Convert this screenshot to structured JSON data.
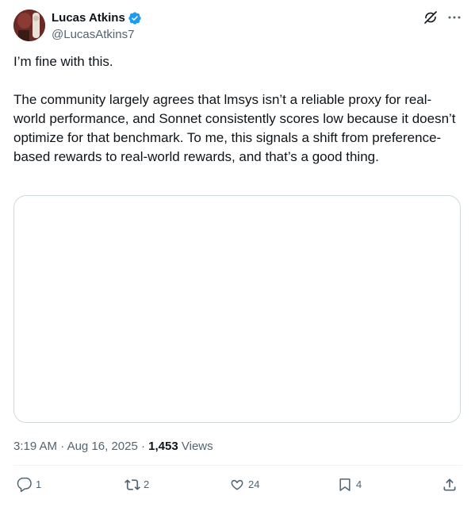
{
  "author": {
    "display_name": "Lucas Atkins",
    "handle": "@LucasAtkins7",
    "verified": true,
    "avatar_icon": "profile-photo"
  },
  "tweet": {
    "paragraphs": [
      "I’m fine with this.",
      "The community largely agrees that lmsys isn’t a reliable proxy for real-world performance, and Sonnet consistently scores low because it doesn’t optimize for that benchmark. To me, this signals a shift from preference-based rewards to real-world rewards, and that’s a good thing."
    ]
  },
  "meta": {
    "time": "3:19 AM",
    "separator": "·",
    "date": "Aug 16, 2025",
    "views_count": "1,453",
    "views_label": "Views"
  },
  "actions": {
    "reply_count": "1",
    "repost_count": "2",
    "like_count": "24",
    "bookmark_count": "4"
  },
  "colors": {
    "text_primary": "#0f1419",
    "text_secondary": "#536471",
    "verified_blue": "#1d9bf0",
    "border": "#cfd9de",
    "divider": "#eff3f4"
  },
  "icons": {
    "grok": "grok-icon",
    "more": "more-icon",
    "reply": "reply-icon",
    "repost": "repost-icon",
    "like": "heart-icon",
    "bookmark": "bookmark-icon",
    "share": "share-icon"
  }
}
